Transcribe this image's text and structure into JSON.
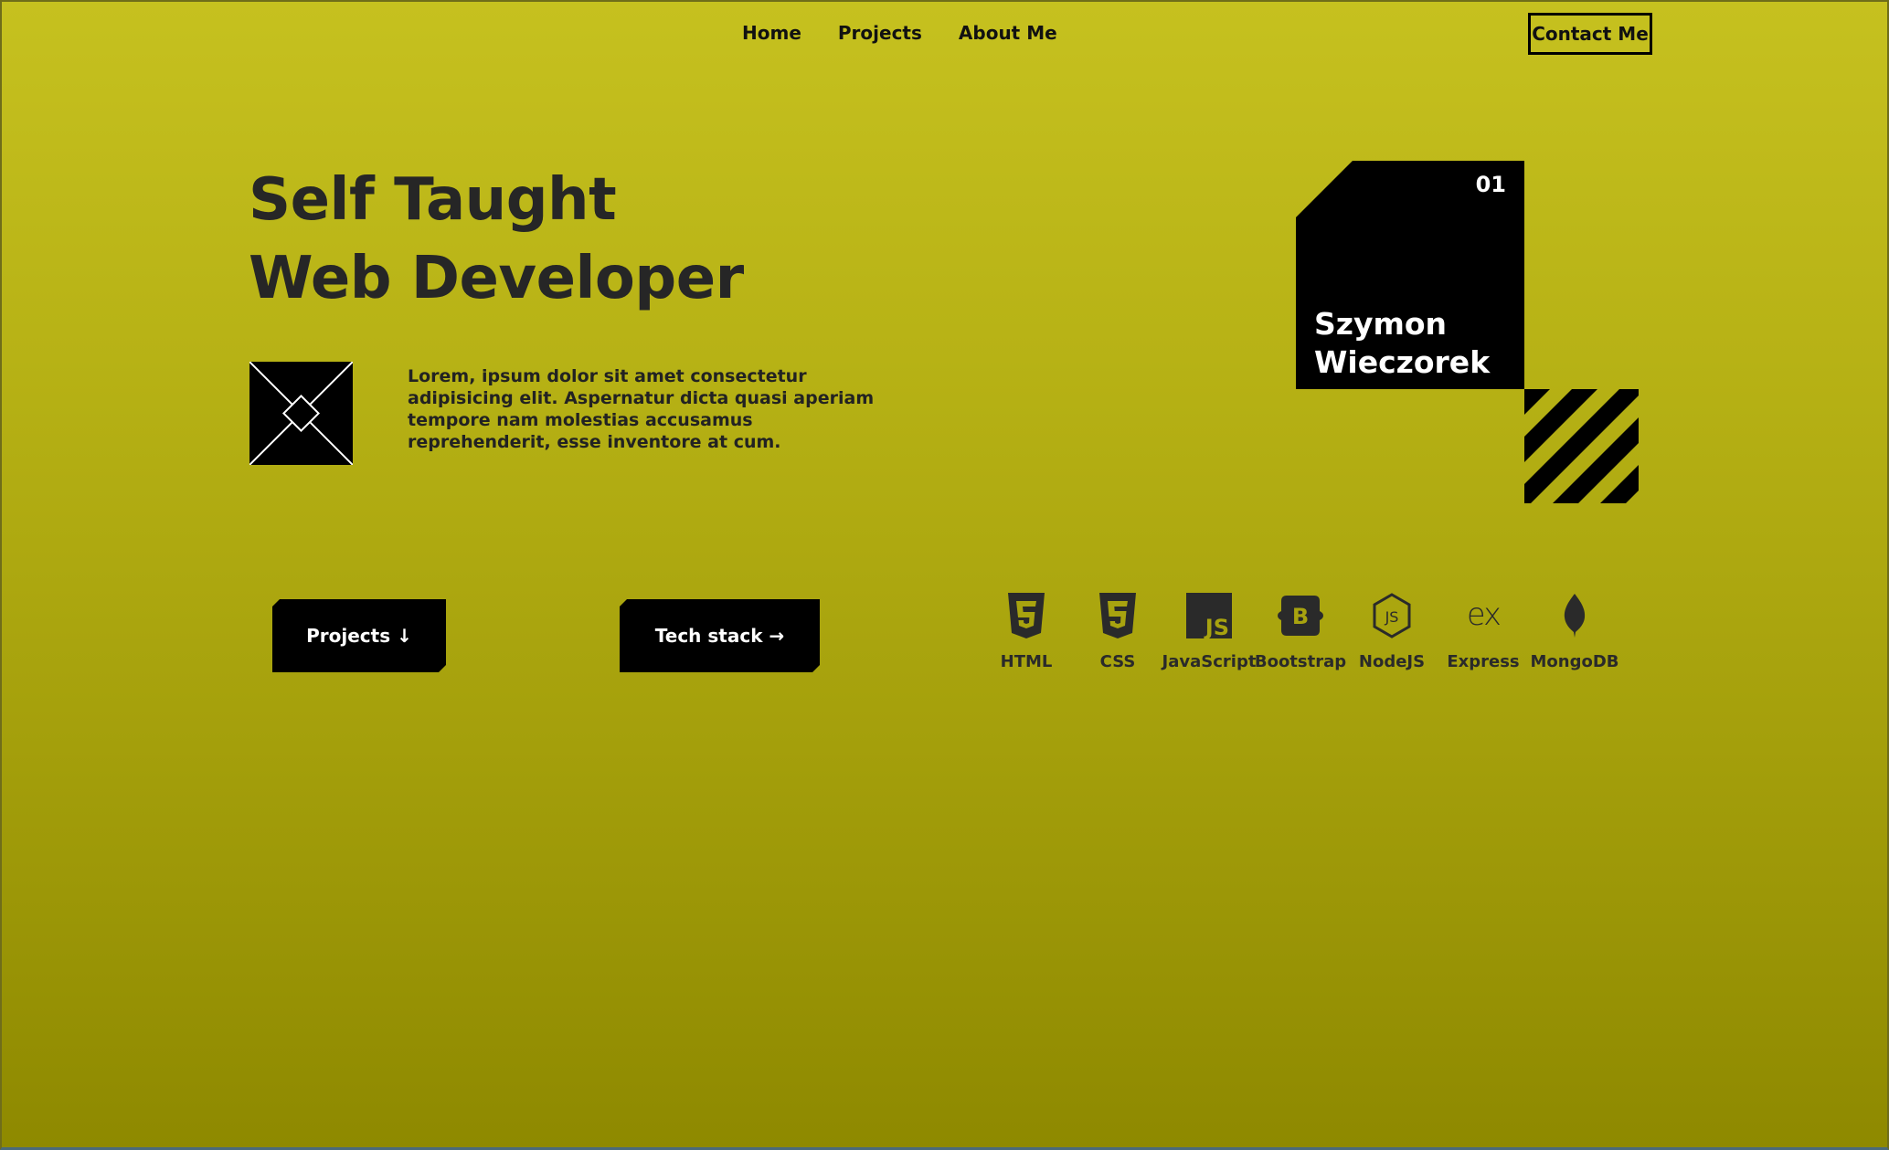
{
  "nav": {
    "items": [
      {
        "label": "Home"
      },
      {
        "label": "Projects"
      },
      {
        "label": "About Me"
      }
    ],
    "contact_label": "Contact Me"
  },
  "hero": {
    "title_line1": "Self Taught",
    "title_line2": "Web Developer",
    "logo_icon": "diamond-cross-logo-icon",
    "description": "Lorem, ipsum dolor sit amet consectetur adipisicing elit. Aspernatur dicta quasi aperiam tempore nam molestias accusamus reprehenderit, esse inventore at cum."
  },
  "card": {
    "number": "01",
    "first_name": "Szymon",
    "last_name": "Wieczorek"
  },
  "buttons": {
    "projects_label": "Projects ↓",
    "tech_label": "Tech stack →"
  },
  "tech_stack": [
    {
      "label": "HTML",
      "icon": "html5-icon"
    },
    {
      "label": "CSS",
      "icon": "css3-icon"
    },
    {
      "label": "JavaScript",
      "icon": "javascript-icon"
    },
    {
      "label": "Bootstrap",
      "icon": "bootstrap-icon"
    },
    {
      "label": "NodeJS",
      "icon": "nodejs-icon"
    },
    {
      "label": "Express",
      "icon": "express-icon"
    },
    {
      "label": "MongoDB",
      "icon": "mongodb-icon"
    }
  ],
  "colors": {
    "background_top": "#c6c11f",
    "background_bottom": "#8e8900",
    "ink": "#222222",
    "card": "#000000"
  }
}
